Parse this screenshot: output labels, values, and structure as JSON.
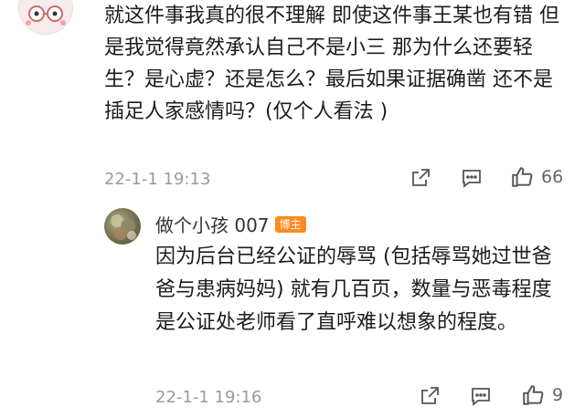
{
  "comment": {
    "text": "就这件事我真的很不理解 即使这件事王某也有错 但是我觉得竟然承认自己不是小三 那为什么还要轻生？是心虚？还是怎么？最后如果证据确凿 还不是插足人家感情吗？(仅个人看法 )",
    "time": "22-1-1 19:13",
    "likes": "66",
    "icons": [
      "share-icon",
      "comment-icon",
      "like-icon"
    ]
  },
  "reply": {
    "author": "做个小孩 007",
    "badge": "博主",
    "text": "因为后台已经公证的辱骂 (包括辱骂她过世爸爸与患病妈妈) 就有几百页，数量与恶毒程度是公证处老师看了直呼难以想象的程度。",
    "time": "22-1-1 19:16",
    "likes": "9",
    "icons": [
      "share-icon",
      "comment-icon",
      "like-icon"
    ]
  },
  "colors": {
    "text": "#1c1c1c",
    "meta": "#9a9a9a",
    "badge": "#ff8a1f"
  }
}
